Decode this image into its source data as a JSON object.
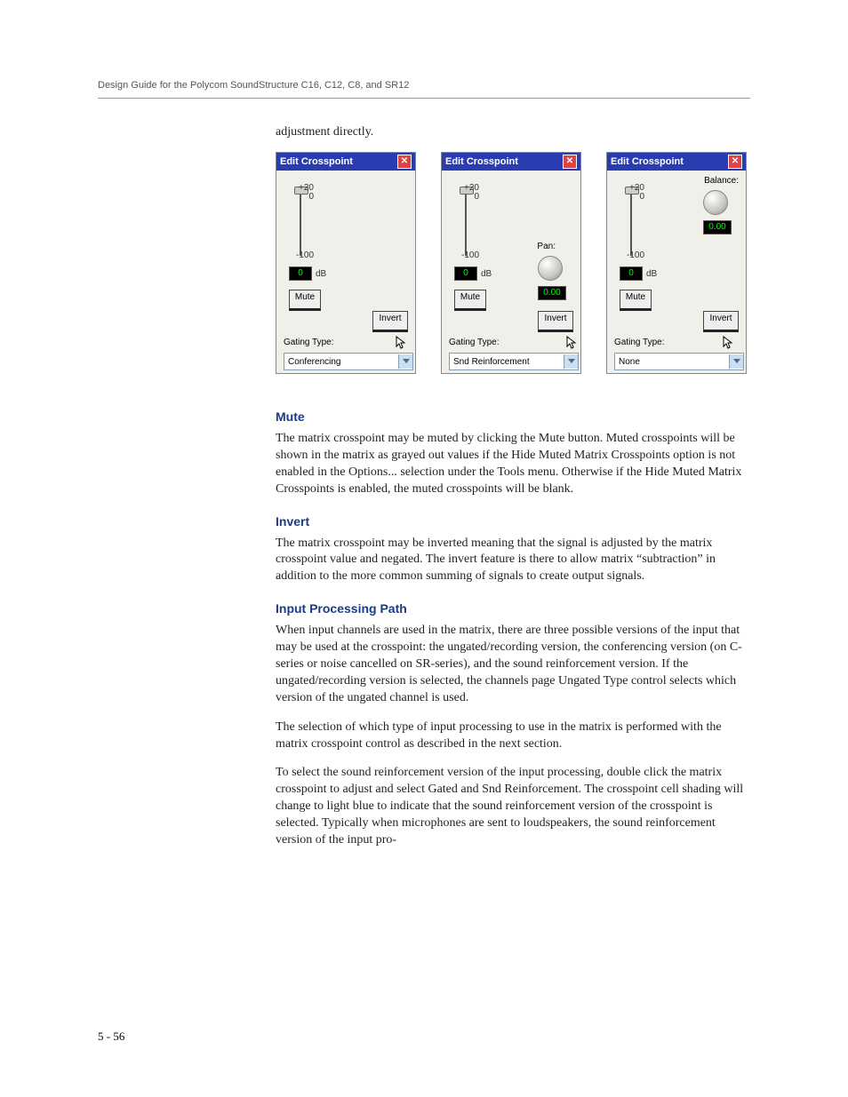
{
  "header": "Design Guide for the Polycom SoundStructure C16, C12, C8, and SR12",
  "intro": "adjustment directly.",
  "panels": [
    {
      "title": "Edit Crosspoint",
      "scale_top": "+20",
      "scale_zero": "0",
      "scale_bottom": "-100",
      "db_value": "0",
      "db_unit": "dB",
      "mute": "Mute",
      "invert": "Invert",
      "gating_label": "Gating Type:",
      "gating_value": "Conferencing",
      "extra": null
    },
    {
      "title": "Edit Crosspoint",
      "scale_top": "+20",
      "scale_zero": "0",
      "scale_bottom": "-100",
      "db_value": "0",
      "db_unit": "dB",
      "mute": "Mute",
      "invert": "Invert",
      "gating_label": "Gating Type:",
      "gating_value": "Snd Reinforcement",
      "extra": {
        "label": "Pan:",
        "readout": "0.00"
      }
    },
    {
      "title": "Edit Crosspoint",
      "scale_top": "+20",
      "scale_zero": "0",
      "scale_bottom": "-100",
      "db_value": "0",
      "db_unit": "dB",
      "mute": "Mute",
      "invert": "Invert",
      "gating_label": "Gating Type:",
      "gating_value": "None",
      "extra": {
        "label": "Balance:",
        "readout": "0.00"
      }
    }
  ],
  "sections": {
    "mute": {
      "heading": "Mute",
      "body": "The matrix crosspoint may be muted by clicking the Mute button. Muted crosspoints will be shown in the matrix as grayed out values if the Hide Muted Matrix Crosspoints option is not enabled in the Options... selection under the Tools menu. Otherwise if the Hide Muted Matrix Crosspoints is enabled, the muted crosspoints will be blank."
    },
    "invert": {
      "heading": "Invert",
      "body": "The matrix crosspoint may be inverted meaning that the signal is adjusted by the matrix crosspoint value and negated. The invert feature is there to allow matrix “subtraction” in addition to the more common summing of signals to create output signals."
    },
    "ipp": {
      "heading": "Input Processing Path",
      "p1": "When input channels are used in the matrix, there are three possible versions of the input that may be used at the crosspoint: the ungated/recording version, the conferencing version (on C-series or noise cancelled on SR-series), and the sound reinforcement version. If the ungated/recording version is selected, the channels page Ungated Type control selects which version of the ungated channel is used.",
      "p2": "The selection of which type of input processing to use in the matrix is performed with the matrix crosspoint control as described in the next section.",
      "p3": "To select the sound reinforcement version of the input processing, double click the matrix crosspoint to adjust and select Gated and Snd Reinforcement. The crosspoint cell shading will change to light blue to indicate that the sound reinforcement version of the crosspoint is selected. Typically when microphones are sent to loudspeakers, the sound reinforcement version of the input pro-"
    }
  },
  "page_number": "5 - 56"
}
